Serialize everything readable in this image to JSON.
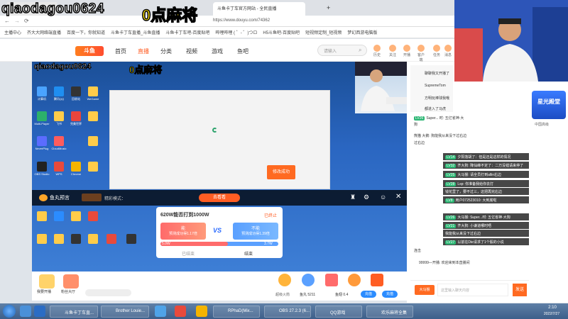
{
  "overlay": {
    "streamer_name": "qiaodagou0624",
    "stream_title": "0点麻将"
  },
  "browser": {
    "tabs": [
      "斗鱼卡丁车官方网站 - 全民直播",
      "",
      ""
    ],
    "url": "https://www.douyu.com/74362",
    "bookmarks": [
      "主播中心",
      "齐大大网络端直播",
      "百度一下，你就知道",
      "斗鱼卡丁车直播_斗鱼直播",
      "斗鱼卡丁车吧-百度贴吧",
      "哔哩哔哩 ( ゜- ゜)つロ",
      "H5斗鱼吧-百度贴吧",
      "短视频定制_短视频",
      "梦幻西游电脑版"
    ]
  },
  "site": {
    "logo": "斗鱼",
    "nav": [
      "首页",
      "直播",
      "分类",
      "视频",
      "游戏",
      "鱼吧"
    ],
    "search_placeholder": "请输入",
    "header_icons": [
      "历史",
      "关注",
      "开播",
      "客户端",
      "任务",
      "消息"
    ]
  },
  "stream": {
    "desktop_icons": [
      "计算机",
      "腾讯QQ",
      "回收站",
      "WeGame",
      "Multi-Player",
      "飞书",
      "完美世界",
      "NeverPlug",
      "CloudMusic",
      "OBS Studio",
      "WPS",
      "Chrome"
    ],
    "dialog_button": "修改成功",
    "overlay_left": "鱼丸预言",
    "overlay_mode": "精彩模式：",
    "overlay_btn": "去看看",
    "poll": {
      "question": "620W能否打到1000W",
      "status": "已终止",
      "option_a": "能",
      "option_a_sub": "预测成功得1.17倍",
      "option_b": "不能",
      "option_b_sub": "预测成功得1.39倍",
      "vs": "VS",
      "left_count": "5.0W",
      "right_count": "3.7W",
      "footer_left": "已结束",
      "footer_right": "结束"
    },
    "bottom_bar": {
      "left_items": [
        "我要开播",
        "粉丝大厅"
      ],
      "fish_label": "鱼丸",
      "fish_value": "5211",
      "coin_label": "鱼翅",
      "coin_value": "0.4",
      "recharge": "充值",
      "gift_names": [
        "超级火箭",
        "飞机",
        "办卡",
        "火箭",
        "鱼翅"
      ]
    }
  },
  "chat": {
    "top_lines": [
      "聊聊我又开播了",
      "SupremeTom",
      "方明玩棒球我哦",
      "都进入了马虎"
    ],
    "lines": [
      {
        "tag": "LV26",
        "text": "Super... 时: 五亿雀神·大"
      },
      {
        "tag": "",
        "text": "狗"
      },
      {
        "tag": "",
        "text": "熊猫 大鹅: 狗能我从来没下过右边"
      },
      {
        "tag": "",
        "text": "过右边"
      },
      {
        "tag": "LV14",
        "text": "夕阳落胡了：但是还是这样的情况"
      },
      {
        "tag": "LV32",
        "text": "齐大狗: 降仙峰不定了：二万没错请来停了"
      },
      {
        "tag": "LV25",
        "text": "大马猴: 请全员打到allin右边"
      },
      {
        "tag": "LV28",
        "text": "Lsp: 你准备我给你去打"
      },
      {
        "tag": "",
        "text": "钱花里了，要不过三，这把再完右边"
      },
      {
        "tag": "LV8",
        "text": "用户072523010: 大到底啦"
      },
      {
        "tag": "LV26",
        "text": "大马猴: Super...时: 五亿雀神·大狗"
      },
      {
        "tag": "LV21",
        "text": "齐大狗: 小谦道哪时唔"
      },
      {
        "tag": "",
        "text": "我能我从来没下过右边"
      },
      {
        "tag": "LV27",
        "text": "以前在Die请求了1个骰的小说"
      },
      {
        "tag": "",
        "text": "连击"
      },
      {
        "tag": "",
        "text": "99999—开播: 欢迎来到本直播间"
      }
    ],
    "input_placeholder": "这里输入聊天内容",
    "send": "发送",
    "bottom_label": "大马猴"
  },
  "star": {
    "title": "星光殿堂",
    "label": "中国高级"
  },
  "taskbar": {
    "items": [
      "斗鱼卡丁车直...",
      "Brother Louie...",
      "",
      "",
      "",
      "",
      "RPhaD(Mix...",
      "OBS 27.2.3 (6...",
      "QQ游戏",
      "欢乐麻将全集"
    ],
    "time": "2:10",
    "date": "2022/7/27"
  },
  "colors": {
    "accent": "#ff5d23",
    "taskbar": "#3d5f8a",
    "stream_bg": "#2a66c1",
    "title_yellow": "#ffe400"
  }
}
